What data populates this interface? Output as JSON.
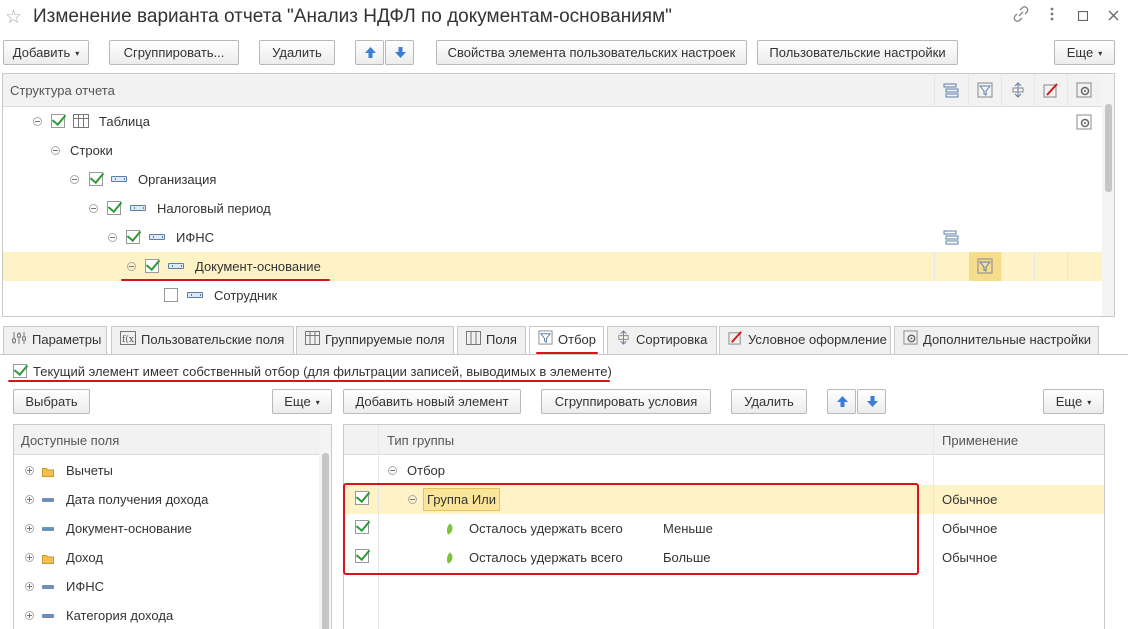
{
  "window": {
    "title": "Изменение варианта отчета \"Анализ НДФЛ по документам-основаниям\""
  },
  "toolbar": {
    "add_label": "Добавить",
    "group_label": "Сгруппировать...",
    "delete_label": "Удалить",
    "element_props_label": "Свойства элемента пользовательских настроек",
    "user_settings_label": "Пользовательские настройки",
    "more_label": "Еще"
  },
  "structure": {
    "header": "Структура отчета",
    "items": [
      {
        "label": "Таблица",
        "checked": true
      },
      {
        "label": "Строки"
      },
      {
        "label": "Организация",
        "checked": true
      },
      {
        "label": "Налоговый период",
        "checked": true
      },
      {
        "label": "ИФНС",
        "checked": true
      },
      {
        "label": "Документ-основание",
        "checked": true,
        "selected": true
      },
      {
        "label": "Сотрудник",
        "checked": false
      }
    ]
  },
  "tabs": [
    {
      "label": "Параметры"
    },
    {
      "label": "Пользовательские поля"
    },
    {
      "label": "Группируемые поля"
    },
    {
      "label": "Поля"
    },
    {
      "label": "Отбор",
      "active": true
    },
    {
      "label": "Сортировка"
    },
    {
      "label": "Условное оформление"
    },
    {
      "label": "Дополнительные настройки"
    }
  ],
  "filter": {
    "own_filter_label": "Текущий элемент имеет собственный отбор (для фильтрации записей, выводимых в элементе)",
    "own_filter_checked": true,
    "select_label": "Выбрать",
    "left_more_label": "Еще",
    "add_new_label": "Добавить новый элемент",
    "group_conditions_label": "Сгруппировать условия",
    "delete_label": "Удалить",
    "right_more_label": "Еще",
    "available_fields_header": "Доступные поля",
    "available_fields": [
      {
        "label": "Вычеты",
        "type": "folder"
      },
      {
        "label": "Дата получения дохода",
        "type": "field"
      },
      {
        "label": "Документ-основание",
        "type": "field"
      },
      {
        "label": "Доход",
        "type": "folder"
      },
      {
        "label": "ИФНС",
        "type": "field"
      },
      {
        "label": "Категория дохода",
        "type": "field"
      }
    ],
    "conditions_header_type": "Тип группы",
    "conditions_header_apply": "Применение",
    "root_label": "Отбор",
    "group_label": "Группа Или",
    "group_apply": "Обычное",
    "conditions": [
      {
        "field": "Осталось удержать всего",
        "comparison": "Меньше",
        "apply": "Обычное",
        "checked": true
      },
      {
        "field": "Осталось удержать всего",
        "comparison": "Больше",
        "apply": "Обычное",
        "checked": true
      }
    ]
  },
  "colors": {
    "selection": "#fdf3c6",
    "accent_red": "#d8141b",
    "check_green": "#2e9b3a"
  }
}
